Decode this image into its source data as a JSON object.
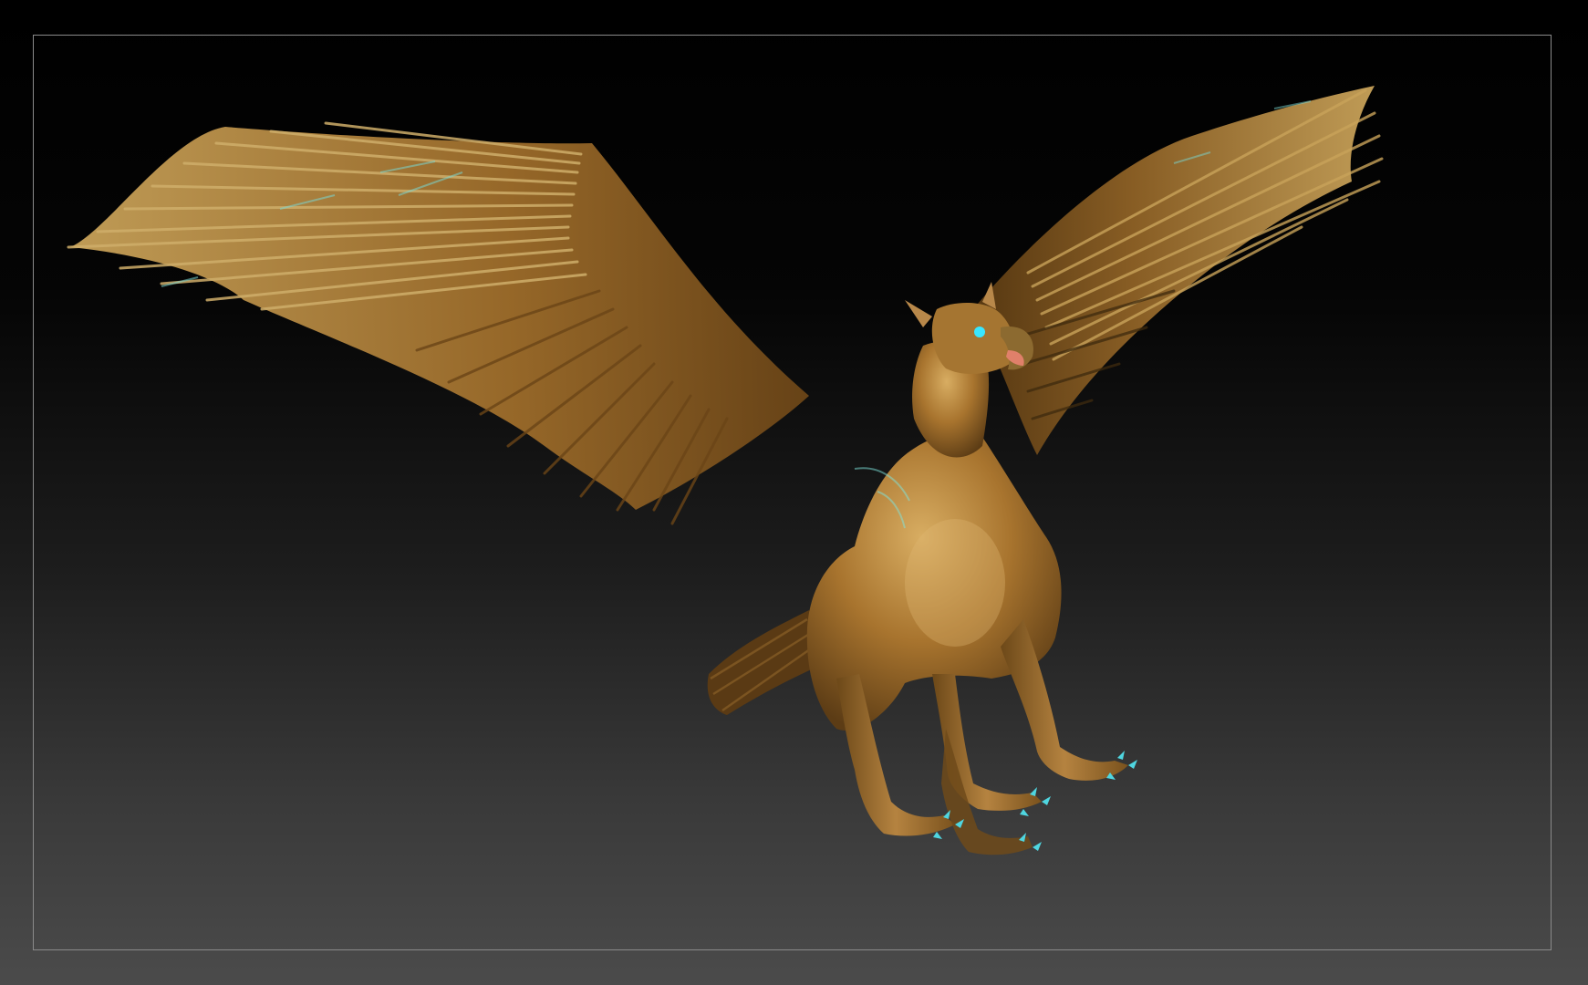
{
  "viewport": {
    "subject": "griffin-sculpt",
    "background_top": "#000000",
    "background_bottom": "#4b4b4b",
    "frame_color": "#8a8a8a"
  },
  "model": {
    "body_color": "#a5722c",
    "highlight_color": "#d9b060",
    "shadow_color": "#3a2810",
    "rim_light_color": "#66e0d8",
    "eye_color": "#39e7ff",
    "beak_inner_color": "#e0806a"
  }
}
